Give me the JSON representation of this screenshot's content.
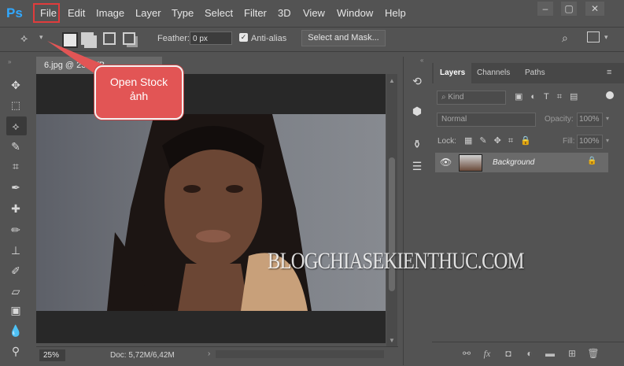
{
  "app": {
    "logo": "Ps"
  },
  "menu": [
    "File",
    "Edit",
    "Image",
    "Layer",
    "Type",
    "Select",
    "Filter",
    "3D",
    "View",
    "Window",
    "Help"
  ],
  "window_controls": [
    "minimize",
    "restore",
    "close"
  ],
  "options": {
    "feather_label": "Feather:",
    "feather_value": "0 px",
    "antialias_label": "Anti-alias",
    "antialias_checked": true,
    "select_mask_label": "Select and Mask..."
  },
  "document": {
    "tab_title": "6.jpg @ 25% (B",
    "zoom": "25%",
    "doc_info": "Doc: 5,72M/6,42M"
  },
  "callout": {
    "text_line1": "Open Stock",
    "text_line2": "ảnh",
    "color": "#e25555"
  },
  "layers_panel": {
    "tabs": [
      "Layers",
      "Channels",
      "Paths"
    ],
    "kind_filter": "Kind",
    "blend_mode": "Normal",
    "opacity_label": "Opacity:",
    "opacity_value": "100%",
    "lock_label": "Lock:",
    "fill_label": "Fill:",
    "fill_value": "100%",
    "layers": [
      {
        "name": "Background",
        "visible": true,
        "locked": true
      }
    ]
  },
  "watermark": "BLOGCHIASEKIENTHUC.COM",
  "colors": {
    "accent": "#31a8ff",
    "highlight": "#e03c3c",
    "ui_bg": "#535353"
  }
}
